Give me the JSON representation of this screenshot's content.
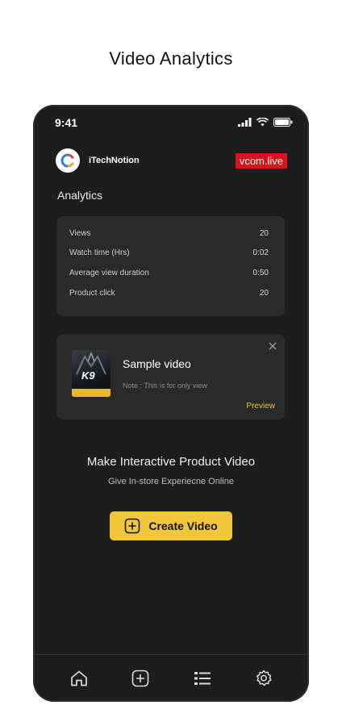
{
  "page": {
    "heading": "Video Analytics"
  },
  "status_bar": {
    "time": "9:41"
  },
  "header": {
    "brand_name": "iTechNotion",
    "badge": "vcom.live"
  },
  "analytics": {
    "title": "Analytics",
    "rows": [
      {
        "label": "Views",
        "value": "20"
      },
      {
        "label": "Watch time (Hrs)",
        "value": "0:02"
      },
      {
        "label": "Average view duration",
        "value": "0:50"
      },
      {
        "label": "Product click",
        "value": "20"
      }
    ]
  },
  "video_card": {
    "thumbnail_text": "K9",
    "title": "Sample video",
    "note": "Note : This is for only view",
    "preview_label": "Preview",
    "close_icon": "close-icon"
  },
  "cta": {
    "title": "Make Interactive Product Video",
    "subtitle": "Give In-store Experiecne Online",
    "button_label": "Create Video"
  },
  "tabbar": {
    "icons": [
      "home-icon",
      "add-square-icon",
      "list-icon",
      "settings-icon"
    ]
  },
  "colors": {
    "accent_yellow": "#f2c63a",
    "badge_red": "#d6141c",
    "phone_background": "#1d1d1d",
    "card_background": "#2a2a2a"
  }
}
